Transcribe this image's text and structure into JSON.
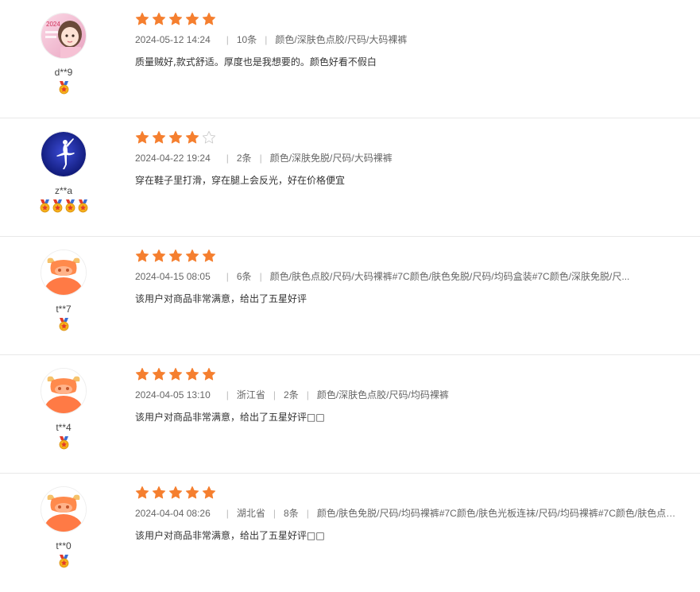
{
  "reviews": [
    {
      "user": "d**9",
      "avatar": "girl-photo-avatar",
      "rating": 5,
      "medals": 1,
      "date": "2024-05-12 14:24",
      "region": "",
      "count": "10条",
      "spec": "颜色/深肤色点胶/尺码/大码裸裤",
      "comment": "质量贼好,款式舒适。厚度也是我想要的。颜色好看不假白"
    },
    {
      "user": "z**a",
      "avatar": "dancer-avatar",
      "rating": 4,
      "medals": 4,
      "date": "2024-04-22 19:24",
      "region": "",
      "count": "2条",
      "spec": "颜色/深肤免脱/尺码/大码裸裤",
      "comment": "穿在鞋子里打滑，穿在腿上会反光，好在价格便宜"
    },
    {
      "user": "t**7",
      "avatar": "bull-avatar",
      "rating": 5,
      "medals": 1,
      "date": "2024-04-15 08:05",
      "region": "",
      "count": "6条",
      "spec": "颜色/肤色点胶/尺码/大码裸裤#7C颜色/肤色免脱/尺码/均码盒装#7C颜色/深肤免脱/尺...",
      "comment": "该用户对商品非常满意，给出了五星好评"
    },
    {
      "user": "t**4",
      "avatar": "bull-avatar",
      "rating": 5,
      "medals": 1,
      "date": "2024-04-05 13:10",
      "region": "浙江省",
      "count": "2条",
      "spec": "颜色/深肤色点胶/尺码/均码裸裤",
      "comment": "该用户对商品非常满意，给出了五星好评□□"
    },
    {
      "user": "t**0",
      "avatar": "bull-avatar",
      "rating": 5,
      "medals": 1,
      "date": "2024-04-04 08:26",
      "region": "湖北省",
      "count": "8条",
      "spec": "颜色/肤色免脱/尺码/均码裸裤#7C颜色/肤色光板连袜/尺码/均码裸裤#7C颜色/肤色点胶...",
      "comment": "该用户对商品非常满意，给出了五星好评□□"
    }
  ],
  "colors": {
    "star_on": "#f57f2f",
    "star_off": "#cccccc",
    "medal_gold": "#f6b21a",
    "medal_red": "#e23b2a"
  }
}
